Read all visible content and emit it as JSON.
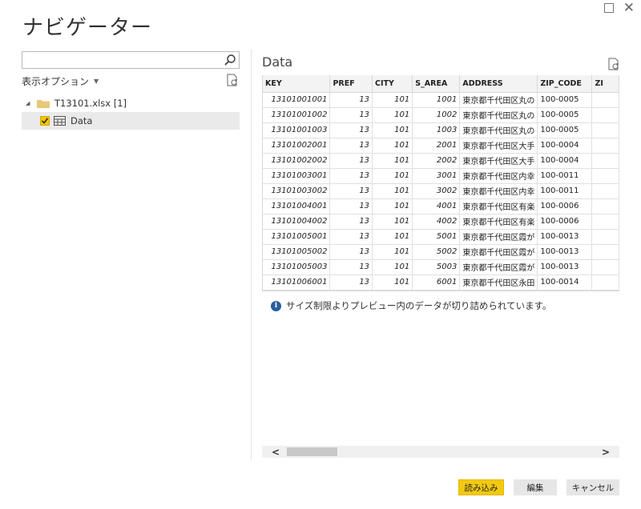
{
  "window": {
    "title": "ナビゲーター",
    "maximize_icon": "maximize-icon",
    "close_glyph": "✕"
  },
  "left_pane": {
    "search": {
      "value": "",
      "placeholder": ""
    },
    "display_options_label": "表示オプション",
    "tree": {
      "root_label": "T13101.xlsx [1]",
      "child_label": "Data",
      "child_checked": true
    }
  },
  "preview": {
    "title": "Data",
    "columns": [
      "KEY",
      "PREF",
      "CITY",
      "S_AREA",
      "ADDRESS",
      "ZIP_CODE",
      "ZI"
    ],
    "rows": [
      [
        "13101001001",
        "13",
        "101",
        "1001",
        "東京都千代田区丸の",
        "100-0005",
        ""
      ],
      [
        "13101001002",
        "13",
        "101",
        "1002",
        "東京都千代田区丸の",
        "100-0005",
        ""
      ],
      [
        "13101001003",
        "13",
        "101",
        "1003",
        "東京都千代田区丸の",
        "100-0005",
        ""
      ],
      [
        "13101002001",
        "13",
        "101",
        "2001",
        "東京都千代田区大手",
        "100-0004",
        ""
      ],
      [
        "13101002002",
        "13",
        "101",
        "2002",
        "東京都千代田区大手",
        "100-0004",
        ""
      ],
      [
        "13101003001",
        "13",
        "101",
        "3001",
        "東京都千代田区内幸",
        "100-0011",
        ""
      ],
      [
        "13101003002",
        "13",
        "101",
        "3002",
        "東京都千代田区内幸",
        "100-0011",
        ""
      ],
      [
        "13101004001",
        "13",
        "101",
        "4001",
        "東京都千代田区有楽",
        "100-0006",
        ""
      ],
      [
        "13101004002",
        "13",
        "101",
        "4002",
        "東京都千代田区有楽",
        "100-0006",
        ""
      ],
      [
        "13101005001",
        "13",
        "101",
        "5001",
        "東京都千代田区霞が",
        "100-0013",
        ""
      ],
      [
        "13101005002",
        "13",
        "101",
        "5002",
        "東京都千代田区霞が",
        "100-0013",
        ""
      ],
      [
        "13101005003",
        "13",
        "101",
        "5003",
        "東京都千代田区霞が",
        "100-0013",
        ""
      ],
      [
        "13101006001",
        "13",
        "101",
        "6001",
        "東京都千代田区永田",
        "100-0014",
        ""
      ]
    ],
    "info_message": "サイズ制限よりプレビュー内のデータが切り詰められています。"
  },
  "footer": {
    "load_label": "読み込み",
    "edit_label": "編集",
    "cancel_label": "キャンセル"
  },
  "colors": {
    "accent": "#f2c811",
    "checkbox": "#f0c400",
    "info_icon": "#2b5d9c",
    "folder": "#e8c77a"
  }
}
